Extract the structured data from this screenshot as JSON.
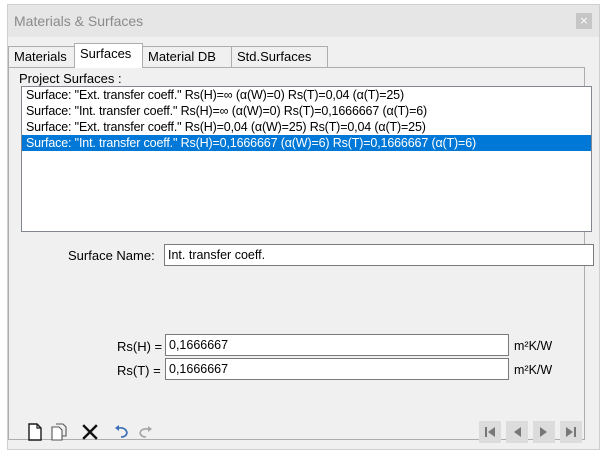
{
  "window": {
    "title": "Materials & Surfaces",
    "close_glyph": "×"
  },
  "tabs": [
    {
      "label": "Materials"
    },
    {
      "label": "Surfaces"
    },
    {
      "label": "Material DB"
    },
    {
      "label": "Std.Surfaces"
    }
  ],
  "project_surfaces": {
    "label": "Project Surfaces :",
    "items": [
      "Surface: \"Ext. transfer coeff.\"  Rs(H)=∞  (α(W)=0)  Rs(T)=0,04  (α(T)=25)",
      "Surface: \"Int. transfer coeff.\"  Rs(H)=∞  (α(W)=0)  Rs(T)=0,1666667  (α(T)=6)",
      "Surface: \"Ext. transfer coeff.\"  Rs(H)=0,04  (α(W)=25)  Rs(T)=0,04  (α(T)=25)",
      "Surface: \"Int. transfer coeff.\"  Rs(H)=0,1666667  (α(W)=6)  Rs(T)=0,1666667  (α(T)=6)"
    ],
    "selected_index": 3
  },
  "surface_name": {
    "label": "Surface Name:",
    "value": "Int. transfer coeff."
  },
  "rs_h": {
    "label": "Rs(H) =",
    "value": "0,1666667",
    "unit": "m²K/W"
  },
  "rs_t": {
    "label": "Rs(T) =",
    "value": "0,1666667",
    "unit": "m²K/W"
  },
  "toolbar_icons": [
    "new-document-icon",
    "copy-document-icon",
    "delete-icon",
    "undo-icon",
    "redo-icon"
  ],
  "nav_icons": [
    "first-record-icon",
    "previous-record-icon",
    "next-record-icon",
    "last-record-icon"
  ],
  "colors": {
    "selection": "#0078d7",
    "window_bg": "#f0f0f0",
    "title_text": "#8a8a8a"
  }
}
